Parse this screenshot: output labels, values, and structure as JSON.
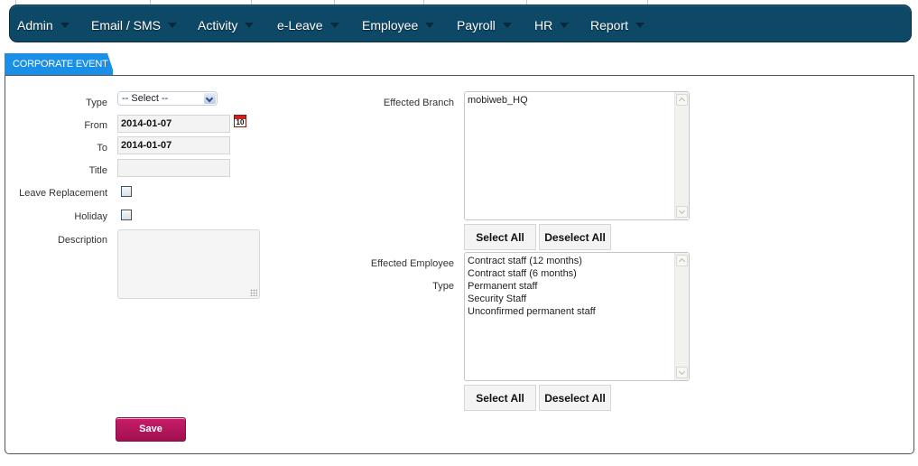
{
  "navbar": {
    "items": [
      {
        "label": "Admin"
      },
      {
        "label": "Email / SMS"
      },
      {
        "label": "Activity"
      },
      {
        "label": "e-Leave"
      },
      {
        "label": "Employee"
      },
      {
        "label": "Payroll"
      },
      {
        "label": "HR"
      },
      {
        "label": "Report"
      }
    ]
  },
  "tab": {
    "label": "CORPORATE EVENT"
  },
  "form": {
    "type": {
      "label": "Type",
      "value": "-- Select --"
    },
    "from": {
      "label": "From",
      "value": "2014-01-07",
      "icon": "calendar-icon",
      "icon_text": "10"
    },
    "to": {
      "label": "To",
      "value": "2014-01-07"
    },
    "title": {
      "label": "Title",
      "value": ""
    },
    "leave_replacement": {
      "label": "Leave Replacement",
      "checked": false
    },
    "holiday": {
      "label": "Holiday",
      "checked": false
    },
    "description": {
      "label": "Description",
      "value": ""
    },
    "effected_branch": {
      "label": "Effected Branch",
      "options": [
        "mobiweb_HQ"
      ],
      "select_all": "Select All",
      "deselect_all": "Deselect All"
    },
    "effected_employee_type": {
      "label_line1": "Effected Employee",
      "label_line2": "Type",
      "options": [
        "Contract staff (12 months)",
        "Contract staff (6 months)",
        "Permanent staff",
        "Security Staff",
        "Unconfirmed permanent staff"
      ],
      "select_all": "Select All",
      "deselect_all": "Deselect All"
    },
    "save_label": "Save"
  },
  "colors": {
    "navbar_bg": "#0e4867",
    "tab_bg": "#1a8fe8",
    "save_bg": "#b3165c"
  }
}
